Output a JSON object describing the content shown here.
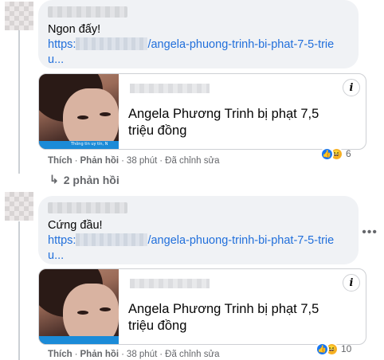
{
  "comments": [
    {
      "text": "Ngon đấy!",
      "link_prefix": "https:",
      "link_suffix": "/angela-phuong-trinh-bi-phat-7-5-trieu...",
      "card_title": "Angela Phương Trinh bị phạt 7,5 triệu đồng",
      "card_band_text": "Thông tin uy tín, N",
      "actions": {
        "like": "Thích",
        "reply": "Phản hồi",
        "time": "38 phút",
        "edited": "Đã chỉnh sửa"
      },
      "reaction_count": "6"
    },
    {
      "text": "Cứng đầu!",
      "link_prefix": "https:",
      "link_suffix": "/angela-phuong-trinh-bi-phat-7-5-trieu...",
      "card_title": "Angela Phương Trinh bị phạt 7,5 triệu đồng",
      "actions": {
        "like": "Thích",
        "reply": "Phản hồi",
        "time": "38 phút",
        "edited": "Đã chỉnh sửa"
      },
      "reaction_count": "10"
    }
  ],
  "replies_link": "2 phản hồi",
  "icons": {
    "info": "i",
    "more": "•••",
    "reply_arrow": "↳",
    "like_reaction": "👍",
    "haha_reaction": "😆"
  },
  "colors": {
    "link": "#216fdb",
    "bubble": "#f0f2f5",
    "like": "#1877f2",
    "haha": "#f7b125"
  }
}
